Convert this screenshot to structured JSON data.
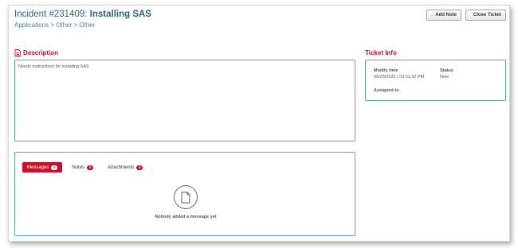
{
  "header": {
    "incident_prefix": "Incident #231409:",
    "incident_title": "Installing SAS",
    "breadcrumb": "Applications > Other > Other"
  },
  "toolbar": {
    "add_note_label": "Add Note",
    "close_ticket_label": "Close Ticket"
  },
  "description": {
    "heading": "Description",
    "text": "Needs instructions for installing SAS"
  },
  "ticket_info": {
    "heading": "Ticket Info",
    "modify_time_label": "Modify time",
    "modify_time_value": "09/25/2025 | 03:01:32 PM",
    "status_label": "Status",
    "status_value": "New",
    "assigned_to_label": "Assigned to"
  },
  "tabs": [
    {
      "label": "Messages",
      "count": "0",
      "active": true
    },
    {
      "label": "Notes",
      "count": "0",
      "active": false
    },
    {
      "label": "Attachments",
      "count": "0",
      "active": false
    }
  ],
  "messages": {
    "empty_text": "Nobody added a message yet"
  },
  "colors": {
    "accent": "#c8102e",
    "title": "#2f5f82",
    "panel_border": "#5aa6b5"
  },
  "icons": {
    "add_note": "note-icon",
    "close_ticket": "close-ticket-icon",
    "description": "document-icon",
    "empty_messages": "blank-document-icon"
  }
}
